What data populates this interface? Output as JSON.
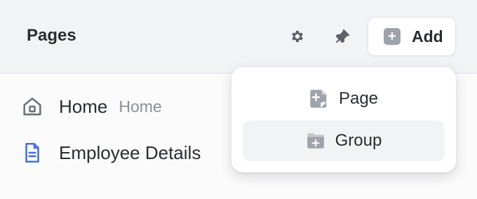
{
  "header": {
    "title": "Pages",
    "settings_icon": "gear-icon",
    "pin_icon": "pin-icon",
    "add_label": "Add",
    "add_icon": "plus-square-icon"
  },
  "pages": [
    {
      "label": "Home",
      "secondary": "Home",
      "icon": "home-icon"
    },
    {
      "label": "Employee Details",
      "icon": "document-icon"
    }
  ],
  "add_menu": {
    "items": [
      {
        "label": "Page",
        "icon": "page-plus-icon"
      },
      {
        "label": "Group",
        "icon": "folder-plus-icon",
        "highlighted": true
      }
    ]
  },
  "colors": {
    "header_bg": "#f2f3f5",
    "icon_gray": "#6b7079",
    "document_blue": "#4a6fd8",
    "highlight_bg": "#f2f3f5"
  }
}
